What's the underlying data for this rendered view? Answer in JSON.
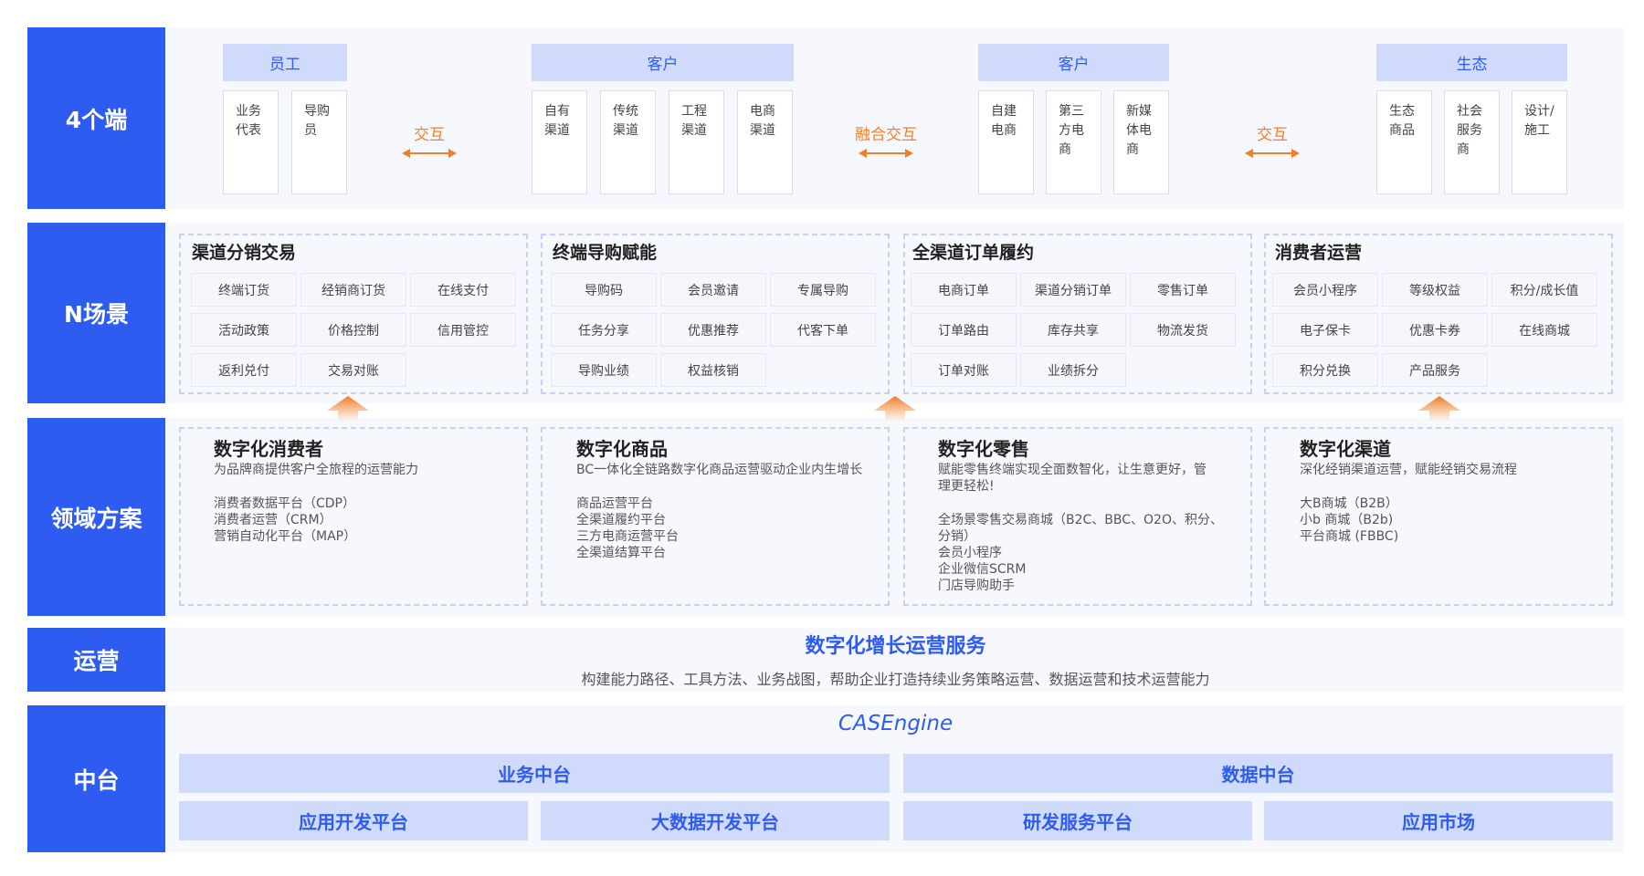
{
  "rows": {
    "terminals": "4个端",
    "scenes": "N场景",
    "domain": "领域方案",
    "ops": "运营",
    "platform": "中台"
  },
  "terminals": {
    "groups": [
      {
        "label": "员工",
        "cards": [
          [
            "业务",
            "代表"
          ],
          [
            "导购",
            "员"
          ]
        ]
      },
      {
        "label": "客户",
        "cards": [
          [
            "自有",
            "渠道"
          ],
          [
            "传统",
            "渠道"
          ],
          [
            "工程",
            "渠道"
          ],
          [
            "电商",
            "渠道"
          ]
        ]
      },
      {
        "label": "客户",
        "cards": [
          [
            "自建",
            "电商"
          ],
          [
            "第三",
            "方电",
            "商"
          ],
          [
            "新媒",
            "体电",
            "商"
          ]
        ]
      },
      {
        "label": "生态",
        "cards": [
          [
            "生态",
            "商品"
          ],
          [
            "社会",
            "服务",
            "商"
          ],
          [
            "设计/",
            "施工"
          ]
        ]
      }
    ],
    "interactions": [
      "交互",
      "融合交互",
      "交互"
    ]
  },
  "scenes": [
    {
      "title": "渠道分销交易",
      "items": [
        "终端订货",
        "经销商订货",
        "在线支付",
        "活动政策",
        "价格控制",
        "信用管控",
        "返利兑付",
        "交易对账"
      ]
    },
    {
      "title": "终端导购赋能",
      "items": [
        "导购码",
        "会员邀请",
        "专属导购",
        "任务分享",
        "优惠推荐",
        "代客下单",
        "导购业绩",
        "权益核销"
      ]
    },
    {
      "title": "全渠道订单履约",
      "items": [
        "电商订单",
        "渠道分销订单",
        "零售订单",
        "订单路由",
        "库存共享",
        "物流发货",
        "订单对账",
        "业绩拆分"
      ]
    },
    {
      "title": "消费者运营",
      "items": [
        "会员小程序",
        "等级权益",
        "积分/成长值",
        "电子保卡",
        "优惠卡券",
        "在线商城",
        "积分兑换",
        "产品服务"
      ]
    }
  ],
  "domains": [
    {
      "title": "数字化消费者",
      "desc": [
        "为品牌商提供客户全旅程的运营能力"
      ],
      "items": [
        "消费者数据平台（CDP）",
        "消费者运营（CRM）",
        "营销自动化平台（MAP）"
      ]
    },
    {
      "title": "数字化商品",
      "desc": [
        "BC一体化全链路数字化商品运营驱动企业内生增长"
      ],
      "items": [
        "商品运营平台",
        "全渠道履约平台",
        "三方电商运营平台",
        "全渠道结算平台"
      ]
    },
    {
      "title": "数字化零售",
      "desc": [
        "赋能零售终端实现全面数智化，让生意更好，管",
        "理更轻松!"
      ],
      "items": [
        "全场景零售交易商城（B2C、BBC、O2O、积分、",
        "分销）",
        "会员小程序",
        "企业微信SCRM",
        "门店导购助手"
      ]
    },
    {
      "title": "数字化渠道",
      "desc": [
        "深化经销渠道运营，赋能经销交易流程"
      ],
      "items": [
        "大B商城（B2B）",
        "小b 商城（B2b)",
        "平台商城 (FBBC)"
      ]
    }
  ],
  "ops": {
    "title": "数字化增长运营服务",
    "desc": "构建能力路径、工具方法、业务战图，帮助企业打造持续业务策略运营、数据运营和技术运营能力"
  },
  "platform": {
    "engine": "CASEngine",
    "top": [
      "业务中台",
      "数据中台"
    ],
    "bottom": [
      "应用开发平台",
      "大数据开发平台",
      "研发服务平台",
      "应用市场"
    ]
  },
  "colors": {
    "primary": "#2f5cf0",
    "accent": "#f07f2a",
    "light": "#d0dbfb"
  }
}
